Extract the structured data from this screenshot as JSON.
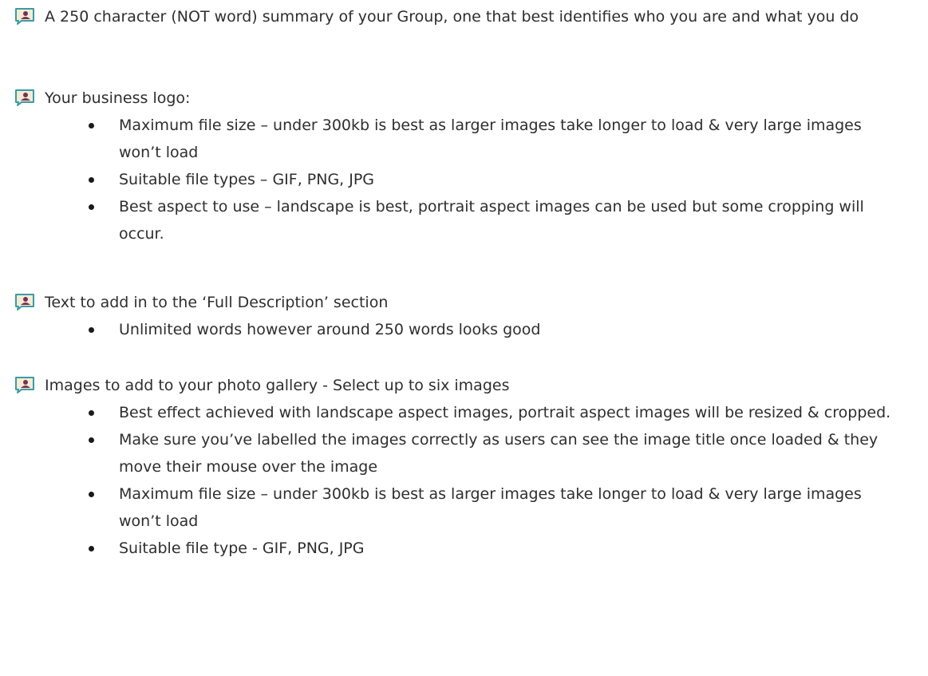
{
  "checklist": [
    {
      "icon": "checkbox-person-icon",
      "text": "A 250 character (NOT word) summary of your Group, one that best identifies who you are and what you do",
      "bullets": []
    },
    {
      "icon": "checkbox-person-icon",
      "text": "Your business logo:",
      "bullets": [
        "Maximum file size – under 300kb is best as larger images take longer to load & very large images won’t load",
        "Suitable file types – GIF, PNG, JPG",
        "Best aspect to use – landscape is best, portrait aspect images can be used but some cropping will occur."
      ]
    },
    {
      "icon": "checkbox-person-icon",
      "text": "Text to add in to the ‘Full Description’ section",
      "bullets": [
        "Unlimited words however around 250 words looks good"
      ]
    },
    {
      "icon": "checkbox-person-icon",
      "text": "Images to add to your photo gallery - Select up to six images",
      "bullets": [
        "Best effect achieved with landscape aspect images, portrait aspect images will be resized & cropped.",
        "Make sure you’ve labelled the images correctly as users can see the image title once loaded & they move their mouse over the image",
        "Maximum file size – under 300kb is best as larger images take longer to load & very large images won’t load",
        "Suitable file type -  GIF, PNG, JPG"
      ]
    }
  ],
  "colors": {
    "text": "#2e2e2e",
    "icon_border": "#3a9ca4",
    "icon_fill": "#f3ecd5",
    "icon_figure": "#7a2f56"
  }
}
